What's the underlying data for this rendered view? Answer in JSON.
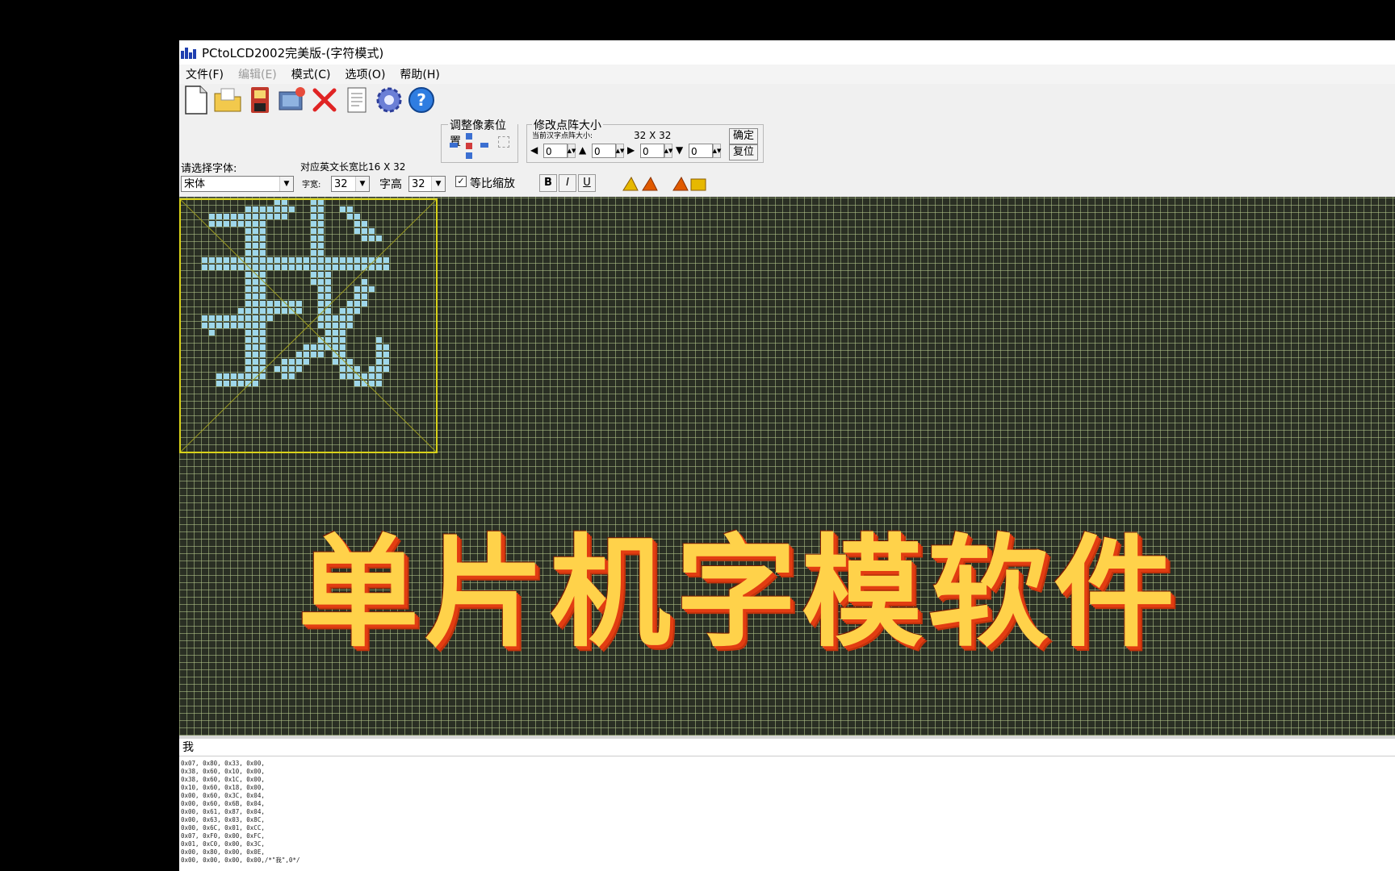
{
  "window": {
    "title": "PCtoLCD2002完美版-(字符模式)"
  },
  "menu": [
    {
      "label": "文件(F)",
      "disabled": false
    },
    {
      "label": "编辑(E)",
      "disabled": true
    },
    {
      "label": "模式(C)",
      "disabled": false
    },
    {
      "label": "选项(O)",
      "disabled": false
    },
    {
      "label": "帮助(H)",
      "disabled": false
    }
  ],
  "toolbar": {
    "font_label": "请选择字体:",
    "font_value": "宋体",
    "ratio_label": "对应英文长宽比16 X 32",
    "width_label": "字宽:",
    "width_value": "32",
    "height_label": "字高",
    "height_value": "32",
    "proportional_label": "等比缩放",
    "proportional_checked": true,
    "adjust_group_title": "调整像素位置",
    "matrix_group_title": "修改点阵大小",
    "current_size_label": "当前汉字点阵大小:",
    "current_size_value": "32 X 32",
    "spin_values": [
      "0",
      "0",
      "0",
      "0"
    ],
    "confirm_label": "确定",
    "reset_label": "复位",
    "bold_label": "B",
    "italic_label": "I",
    "underline_label": "U"
  },
  "canvas": {
    "preview_char": "我",
    "overlay_text": "单片机字模软件",
    "grid_color": "#b4c88c",
    "pixel_color": "#9fd7ea",
    "box_color": "#d9d21a"
  },
  "input_text": "我",
  "output_lines": [
    "0x07, 0x80, 0x33, 0x00,",
    "0x38, 0x60, 0x10, 0x00,",
    "0x38, 0x60, 0x1C, 0x00,",
    "0x10, 0x60, 0x18, 0x00,",
    "0x00, 0x60, 0x3C, 0x04,",
    "0x00, 0x60, 0x6B, 0x04,",
    "0x00, 0x61, 0x87, 0x04,",
    "0x00, 0x63, 0x03, 0x8C,",
    "0x00, 0x6C, 0x01, 0xCC,",
    "0x07, 0xF0, 0x00, 0xFC,",
    "0x01, 0xC0, 0x00, 0x3C,",
    "0x00, 0x80, 0x00, 0x0E,",
    "0x00, 0x00, 0x00, 0x00,/*\"我\",0*/"
  ]
}
